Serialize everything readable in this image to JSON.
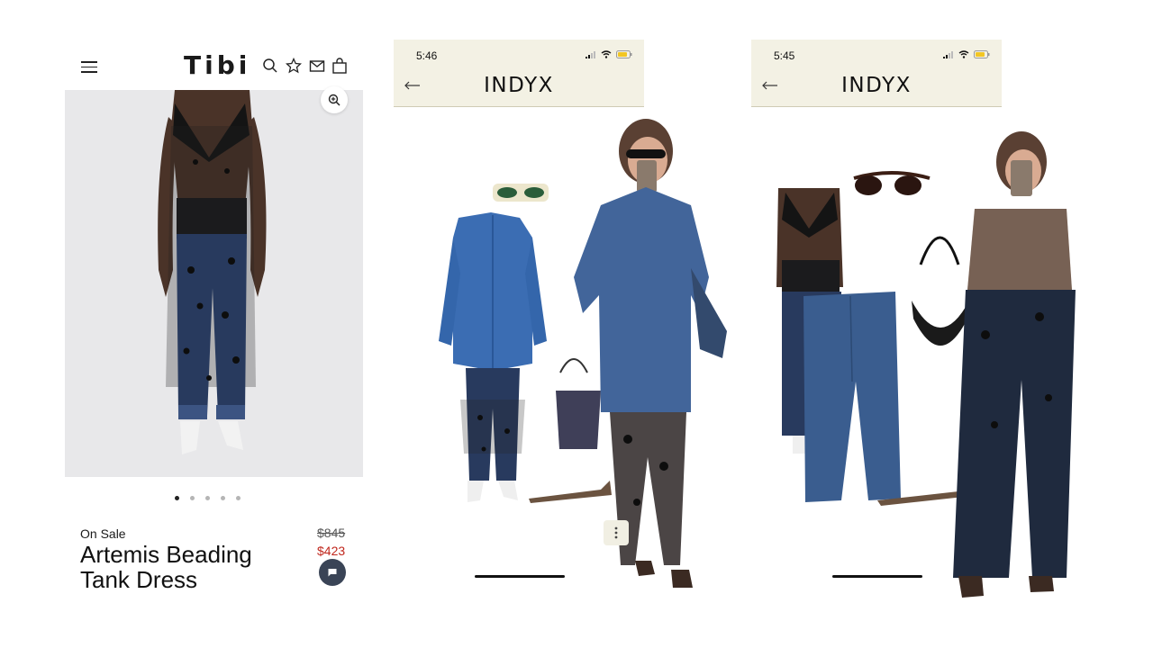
{
  "tibi": {
    "brand": "Tibi",
    "on_sale": "On Sale",
    "title": "Artemis Beading Tank Dress",
    "original_price": "$845",
    "sale_price": "$423",
    "carousel": {
      "count": 5,
      "active_index": 0
    },
    "icons": [
      "menu-icon",
      "search-icon",
      "star-icon",
      "mail-icon",
      "bag-icon",
      "zoom-in-icon",
      "chat-icon"
    ]
  },
  "indyx_1": {
    "time": "5:46",
    "app_title": "INDYX",
    "icons": [
      "signal-icon",
      "wifi-icon",
      "battery-icon",
      "back-arrow-icon",
      "more-vertical-icon"
    ]
  },
  "indyx_2": {
    "time": "5:45",
    "app_title": "INDYX",
    "icons": [
      "signal-icon",
      "wifi-icon",
      "battery-icon",
      "back-arrow-icon"
    ]
  },
  "colors": {
    "sale_red": "#c0261c",
    "indyx_header_bg": "#f3f1e4",
    "chat_button": "#3a4456",
    "denim": "#3a5d8f",
    "dark_denim": "#1f2a3e"
  }
}
